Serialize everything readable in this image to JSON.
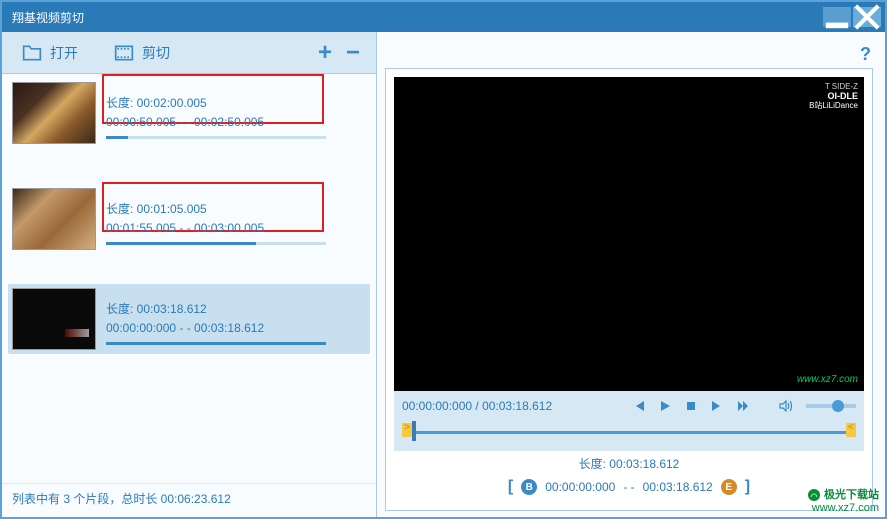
{
  "window": {
    "title": "翔基视频剪切"
  },
  "toolbar": {
    "open_label": "打开",
    "cut_label": "剪切"
  },
  "clips": [
    {
      "duration_label": "长度: 00:02:00.005",
      "range": "00:00:50.005  - -  00:02:50.005",
      "progress": 10
    },
    {
      "duration_label": "长度: 00:01:05.005",
      "range": "00:01:55.005  - -  00:03:00.005",
      "progress": 68
    },
    {
      "duration_label": "长度: 00:03:18.612",
      "range": "00:00:00:000  - -  00:03:18.612",
      "progress": 100
    }
  ],
  "list_footer": "列表中有 3 个片段，总时长 00:06:23.612",
  "player": {
    "time_display": "00:00:00:000 / 00:03:18.612",
    "watermark_top_line1": "T SIDE-Z",
    "watermark_top_line2": "OI-DLE",
    "watermark_top_line3": "B站LiLiDance",
    "watermark_bottom": "www.xz7.com",
    "duration_label": "长度: 00:03:18.612",
    "range_start": "00:00:00:000",
    "range_sep": "- -",
    "range_end": "00:03:18.612"
  },
  "site_watermark": {
    "name": "极光下载站",
    "url": "www.xz7.com"
  }
}
